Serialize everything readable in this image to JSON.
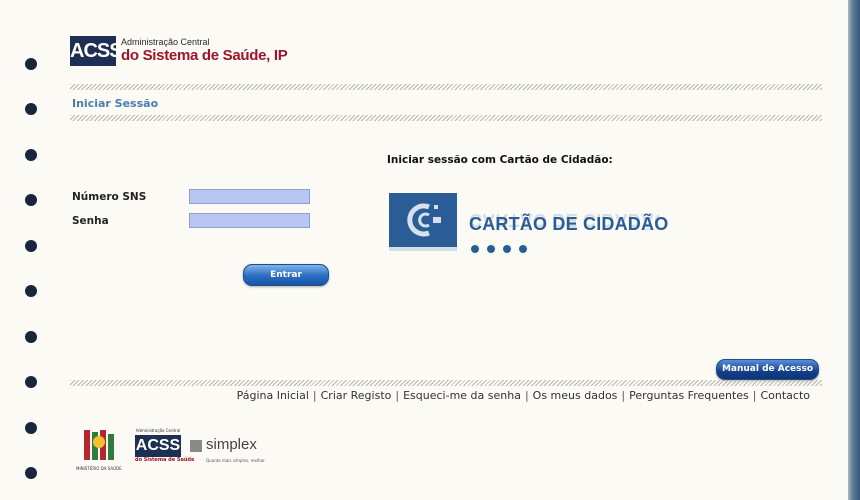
{
  "header": {
    "logo_abbr": "ACSS",
    "logo_line1": "Administração Central",
    "logo_line2": "do Sistema de Saúde, IP"
  },
  "section_title": "Iniciar Sessão",
  "login_form": {
    "sns_label": "Número SNS",
    "sns_value": "",
    "password_label": "Senha",
    "password_value": "",
    "submit_label": "Entrar"
  },
  "citizen_card": {
    "heading": "Iniciar sessão com Cartão de Cidadão:",
    "card_text": "CARTÃO DE CIDADÃO"
  },
  "manual_button": "Manual de Acesso",
  "footer_links": [
    "Página Inicial",
    "Criar Registo",
    "Esqueci-me da senha",
    "Os meus dados",
    "Perguntas Frequentes",
    "Contacto"
  ],
  "bottom_logos": {
    "ministry_caption": "MINISTÉRIO DA SAÚDE",
    "acss_small": "Administração Central",
    "acss_abbr": "ACSS",
    "acss_caption": "do Sistema de Saúde",
    "simplex_name": "simplex",
    "simplex_tagline": "Quanto mais simples, melhor."
  },
  "colors": {
    "accent_blue": "#2a5d96",
    "brand_red": "#a0142a",
    "title_blue": "#4a7eb0"
  }
}
